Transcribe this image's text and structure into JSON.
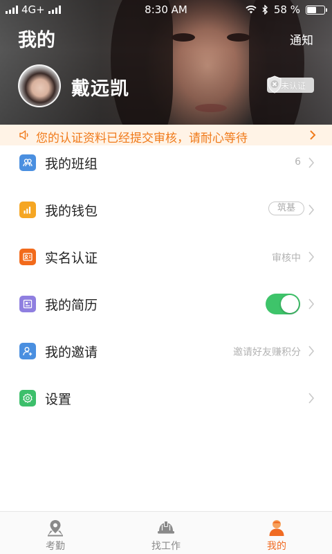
{
  "status_bar": {
    "carrier": "4G+",
    "time": "8:30 AM",
    "battery": "58 %",
    "battery_level": 0.58
  },
  "header": {
    "title": "我的",
    "notice_link": "通知",
    "user_name": "戴远凯",
    "cert_status": "未认证"
  },
  "notice_bar": {
    "message": "您的认证资料已经提交审核，请耐心等待"
  },
  "menu": {
    "items": [
      {
        "label": "我的班组",
        "value": "6",
        "icon": "team-icon",
        "color": "#4a8fe0"
      },
      {
        "label": "我的钱包",
        "value": "筑基",
        "icon": "wallet-chart-icon",
        "color": "#f5a623"
      },
      {
        "label": "实名认证",
        "value": "审核中",
        "icon": "id-card-icon",
        "color": "#f26a1b"
      },
      {
        "label": "我的简历",
        "value": "",
        "icon": "resume-icon",
        "color": "#8f7fe0",
        "toggle_on": true
      },
      {
        "label": "我的邀请",
        "value": "邀请好友赚积分",
        "icon": "invite-user-icon",
        "color": "#4a8fe0"
      },
      {
        "label": "设置",
        "value": "",
        "icon": "settings-icon",
        "color": "#3dbf6b"
      }
    ]
  },
  "bottom_nav": {
    "items": [
      {
        "label": "考勤",
        "icon": "location-pin-icon",
        "active": false
      },
      {
        "label": "找工作",
        "icon": "hard-hat-icon",
        "active": false
      },
      {
        "label": "我的",
        "icon": "profile-icon",
        "active": true
      }
    ],
    "active_color": "#f06b23"
  }
}
